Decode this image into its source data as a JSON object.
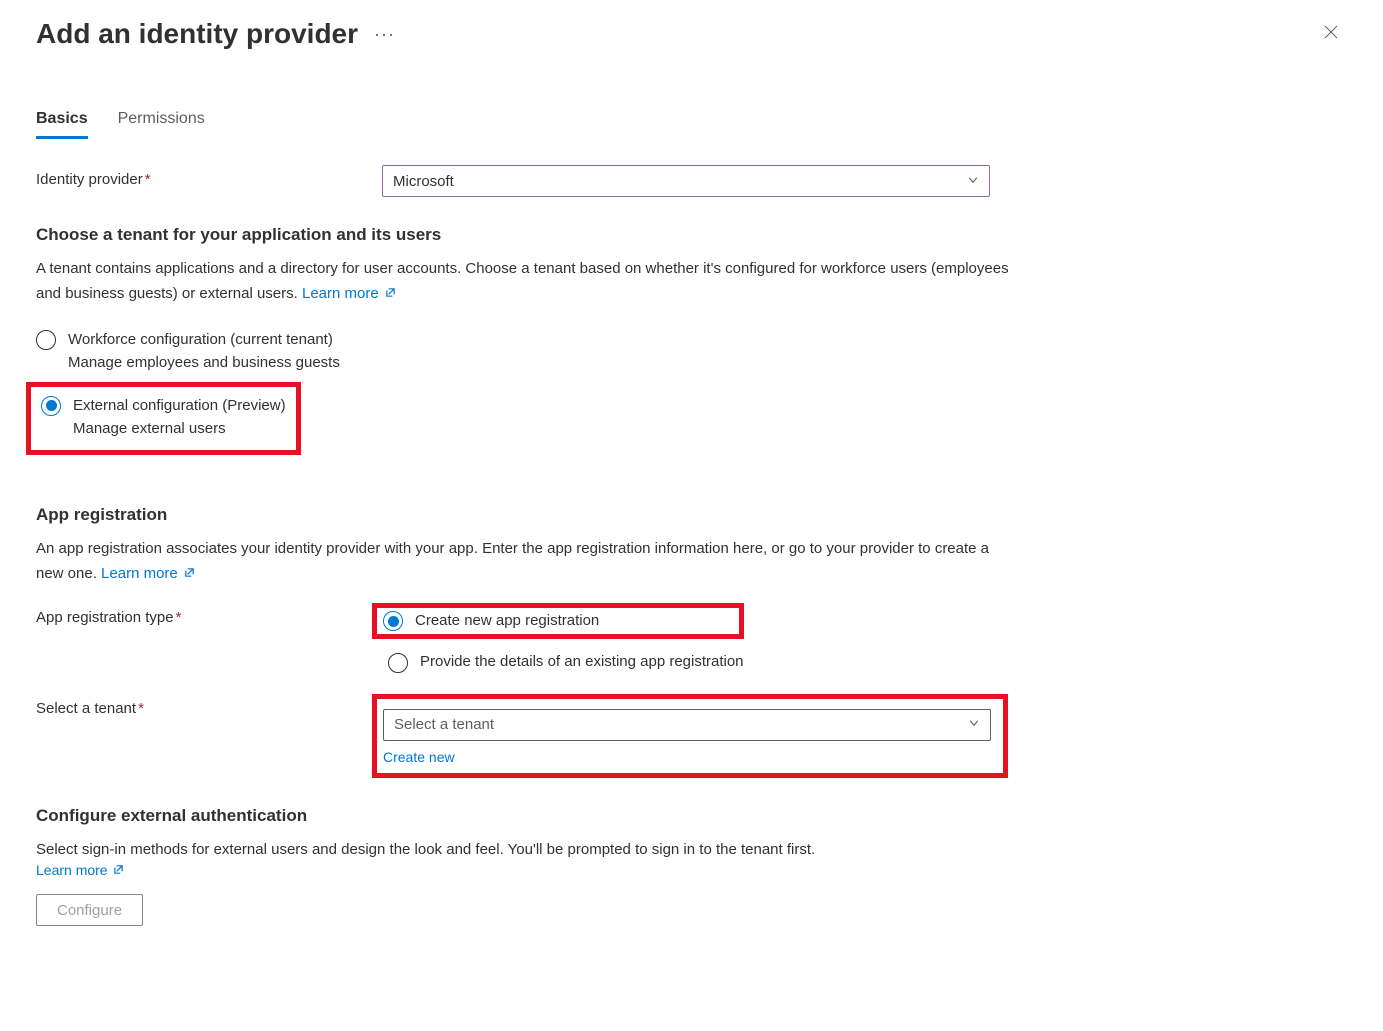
{
  "header": {
    "title": "Add an identity provider"
  },
  "tabs": {
    "basics": "Basics",
    "permissions": "Permissions"
  },
  "identityProvider": {
    "label": "Identity provider",
    "value": "Microsoft"
  },
  "tenantSection": {
    "heading": "Choose a tenant for your application and its users",
    "desc": "A tenant contains applications and a directory for user accounts. Choose a tenant based on whether it's configured for workforce users (employees and business guests) or external users. ",
    "learnMore": "Learn more",
    "options": {
      "workforce": {
        "title": "Workforce configuration (current tenant)",
        "sub": "Manage employees and business guests"
      },
      "external": {
        "title": "External configuration (Preview)",
        "sub": "Manage external users"
      }
    }
  },
  "appReg": {
    "heading": "App registration",
    "desc": "An app registration associates your identity provider with your app. Enter the app registration information here, or go to your provider to create a new one. ",
    "learnMore": "Learn more",
    "typeLabel": "App registration type",
    "options": {
      "create": "Create new app registration",
      "existing": "Provide the details of an existing app registration"
    }
  },
  "selectTenant": {
    "label": "Select a tenant",
    "placeholder": "Select a tenant",
    "createNew": "Create new"
  },
  "externalAuth": {
    "heading": "Configure external authentication",
    "desc": "Select sign-in methods for external users and design the look and feel. You'll be prompted to sign in to the tenant first.",
    "learnMore": "Learn more",
    "configureBtn": "Configure"
  }
}
